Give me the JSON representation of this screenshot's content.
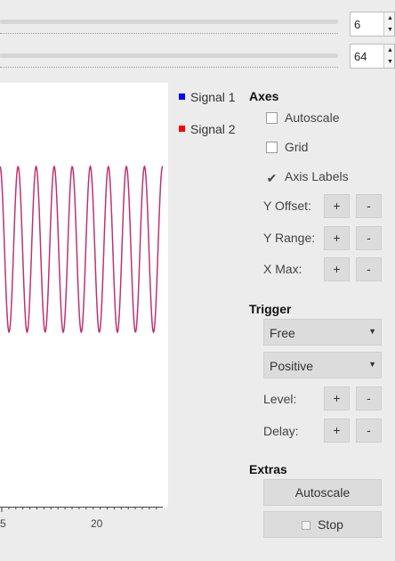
{
  "controls": {
    "slider1_value": "6",
    "slider2_value": "64"
  },
  "chart_data": {
    "type": "line",
    "x_tick_labels": [
      "5",
      "20"
    ],
    "series": [
      {
        "name": "Signal 1",
        "color": "#0000ff"
      },
      {
        "name": "Signal 2",
        "color": "#ff0000"
      }
    ]
  },
  "legend": {
    "items": [
      {
        "label": "Signal 1",
        "color": "#0000ff"
      },
      {
        "label": "Signal 2",
        "color": "#ff0000"
      }
    ]
  },
  "axes": {
    "title": "Axes",
    "autoscale_label": "Autoscale",
    "grid_label": "Grid",
    "axis_labels_label": "Axis Labels",
    "y_offset_label": "Y Offset:",
    "y_range_label": "Y Range:",
    "x_max_label": "X Max:",
    "plus": "+",
    "minus": "-"
  },
  "trigger": {
    "title": "Trigger",
    "mode_value": "Free",
    "slope_value": "Positive",
    "level_label": "Level:",
    "delay_label": "Delay:",
    "plus": "+",
    "minus": "-"
  },
  "extras": {
    "title": "Extras",
    "autoscale_button": "Autoscale",
    "stop_button": "Stop"
  }
}
